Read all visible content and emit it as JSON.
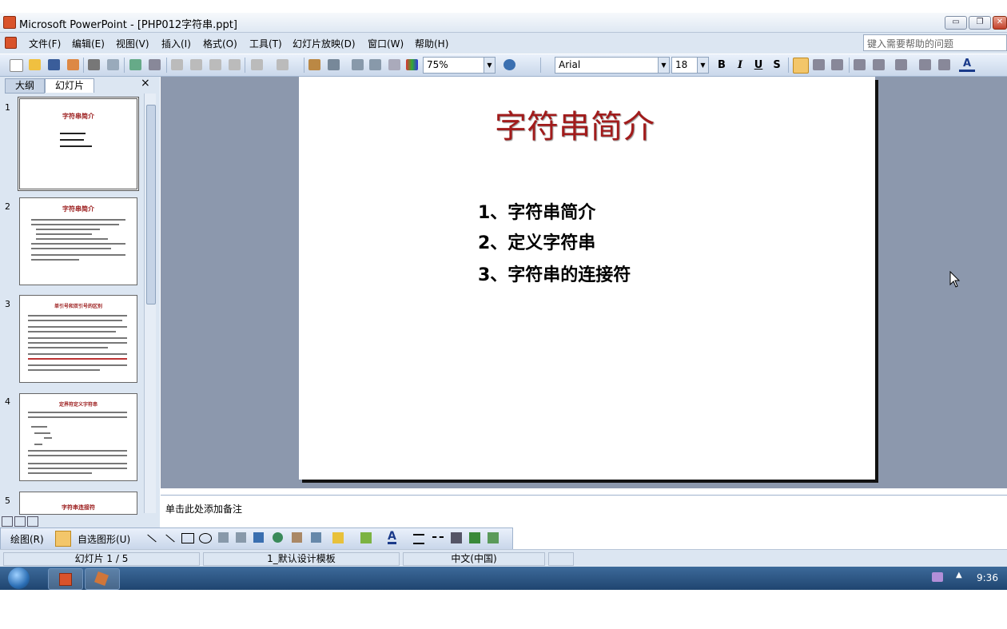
{
  "window": {
    "title": "Microsoft PowerPoint - [PHP012字符串.ppt]",
    "controls": {
      "minimize": "▭",
      "restore": "❐",
      "close": "✕"
    }
  },
  "menu": {
    "items": [
      "文件(F)",
      "编辑(E)",
      "视图(V)",
      "插入(I)",
      "格式(O)",
      "工具(T)",
      "幻灯片放映(D)",
      "窗口(W)",
      "帮助(H)"
    ],
    "help_placeholder": "键入需要帮助的问题"
  },
  "toolbar": {
    "zoom": "75%",
    "font": "Arial",
    "font_size": "18",
    "bold": "B",
    "italic": "I",
    "underline": "U",
    "shadow": "S",
    "font_color_label": "A"
  },
  "panel": {
    "tabs": [
      "大纲",
      "幻灯片"
    ],
    "close": "×",
    "slides": [
      {
        "num": "1",
        "title": "字符串简介"
      },
      {
        "num": "2",
        "title": "字符串简介"
      },
      {
        "num": "3",
        "title": "单引号和双引号的区别"
      },
      {
        "num": "4",
        "title": "定界符定义字符串"
      },
      {
        "num": "5",
        "title": "字符串连接符"
      }
    ]
  },
  "slide": {
    "title": "字符串简介",
    "bullets": [
      "1、字符串简介",
      "2、定义字符串",
      "3、字符串的连接符"
    ]
  },
  "notes": {
    "placeholder": "单击此处添加备注"
  },
  "draw_toolbar": {
    "draw_label": "绘图(R)",
    "autoshapes_label": "自选图形(U)"
  },
  "status": {
    "slide_pos": "幻灯片 1 / 5",
    "template": "1_默认设计模板",
    "language": "中文(中国)"
  },
  "taskbar": {
    "time": "9:36"
  },
  "colors": {
    "title_red": "#a11b1b",
    "workspace": "#8c98ad",
    "ui_blue": "#dce6f2"
  }
}
